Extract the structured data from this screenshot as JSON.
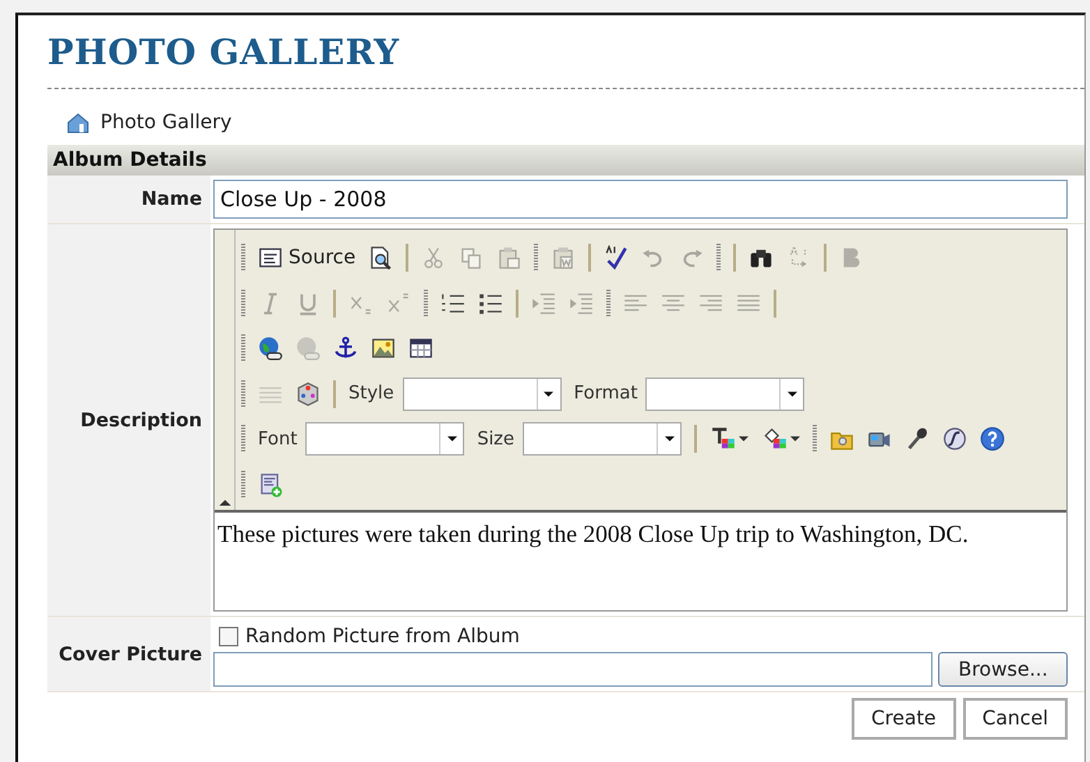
{
  "page_title": "PHOTO GALLERY",
  "breadcrumb": "Photo Gallery",
  "section_title": "Album Details",
  "name_field": {
    "label": "Name",
    "value": "Close Up - 2008"
  },
  "description": {
    "label": "Description",
    "toolbar_rows": [
      [
        {
          "kind": "grip"
        },
        {
          "kind": "source",
          "label": "Source",
          "disabled": false
        },
        {
          "kind": "preview",
          "disabled": false
        },
        {
          "kind": "sep"
        },
        {
          "kind": "cut",
          "disabled": true
        },
        {
          "kind": "copy",
          "disabled": true
        },
        {
          "kind": "paste",
          "disabled": true
        },
        {
          "kind": "grip"
        },
        {
          "kind": "paste-word",
          "disabled": true
        },
        {
          "kind": "sep"
        },
        {
          "kind": "spell",
          "disabled": false
        },
        {
          "kind": "undo",
          "disabled": true
        },
        {
          "kind": "redo",
          "disabled": true
        },
        {
          "kind": "grip"
        },
        {
          "kind": "sep"
        },
        {
          "kind": "find",
          "disabled": false
        },
        {
          "kind": "replace",
          "disabled": true
        },
        {
          "kind": "sep"
        },
        {
          "kind": "bold",
          "disabled": true
        }
      ],
      [
        {
          "kind": "grip"
        },
        {
          "kind": "italic",
          "disabled": true
        },
        {
          "kind": "underline",
          "disabled": true
        },
        {
          "kind": "sep"
        },
        {
          "kind": "subscript",
          "disabled": true
        },
        {
          "kind": "superscript",
          "disabled": true
        },
        {
          "kind": "grip"
        },
        {
          "kind": "ordered-list",
          "disabled": false
        },
        {
          "kind": "bullet-list",
          "disabled": false
        },
        {
          "kind": "sep"
        },
        {
          "kind": "outdent",
          "disabled": true
        },
        {
          "kind": "indent",
          "disabled": true
        },
        {
          "kind": "grip"
        },
        {
          "kind": "align-left",
          "disabled": true
        },
        {
          "kind": "align-center",
          "disabled": true
        },
        {
          "kind": "align-right",
          "disabled": true
        },
        {
          "kind": "justify",
          "disabled": true
        },
        {
          "kind": "sep"
        }
      ],
      [
        {
          "kind": "grip"
        },
        {
          "kind": "link",
          "disabled": false
        },
        {
          "kind": "unlink",
          "disabled": true
        },
        {
          "kind": "anchor",
          "disabled": false
        },
        {
          "kind": "image",
          "disabled": false
        },
        {
          "kind": "table",
          "disabled": false
        }
      ],
      [
        {
          "kind": "grip"
        },
        {
          "kind": "style-list",
          "disabled": true
        },
        {
          "kind": "cube",
          "disabled": false
        },
        {
          "kind": "sep"
        },
        {
          "kind": "combo",
          "label": "Style"
        },
        {
          "kind": "combo",
          "label": "Format"
        }
      ],
      [
        {
          "kind": "grip"
        },
        {
          "kind": "combo",
          "label": "Font"
        },
        {
          "kind": "combo",
          "label": "Size"
        },
        {
          "kind": "sep"
        },
        {
          "kind": "text-color",
          "disabled": false
        },
        {
          "kind": "bg-color",
          "disabled": false
        },
        {
          "kind": "grip"
        },
        {
          "kind": "folder",
          "disabled": false
        },
        {
          "kind": "video",
          "disabled": false
        },
        {
          "kind": "mic",
          "disabled": false
        },
        {
          "kind": "flash",
          "disabled": false
        },
        {
          "kind": "help",
          "disabled": false
        }
      ],
      [
        {
          "kind": "grip"
        },
        {
          "kind": "form-add",
          "disabled": false
        }
      ]
    ],
    "text": "These pictures were taken during the 2008 Close Up trip to Washington, DC."
  },
  "cover_picture": {
    "label": "Cover Picture",
    "checkbox": {
      "label": "Random Picture from Album",
      "checked": false
    },
    "browse_button": "Browse..."
  },
  "buttons": [
    "Create",
    "Cancel"
  ]
}
